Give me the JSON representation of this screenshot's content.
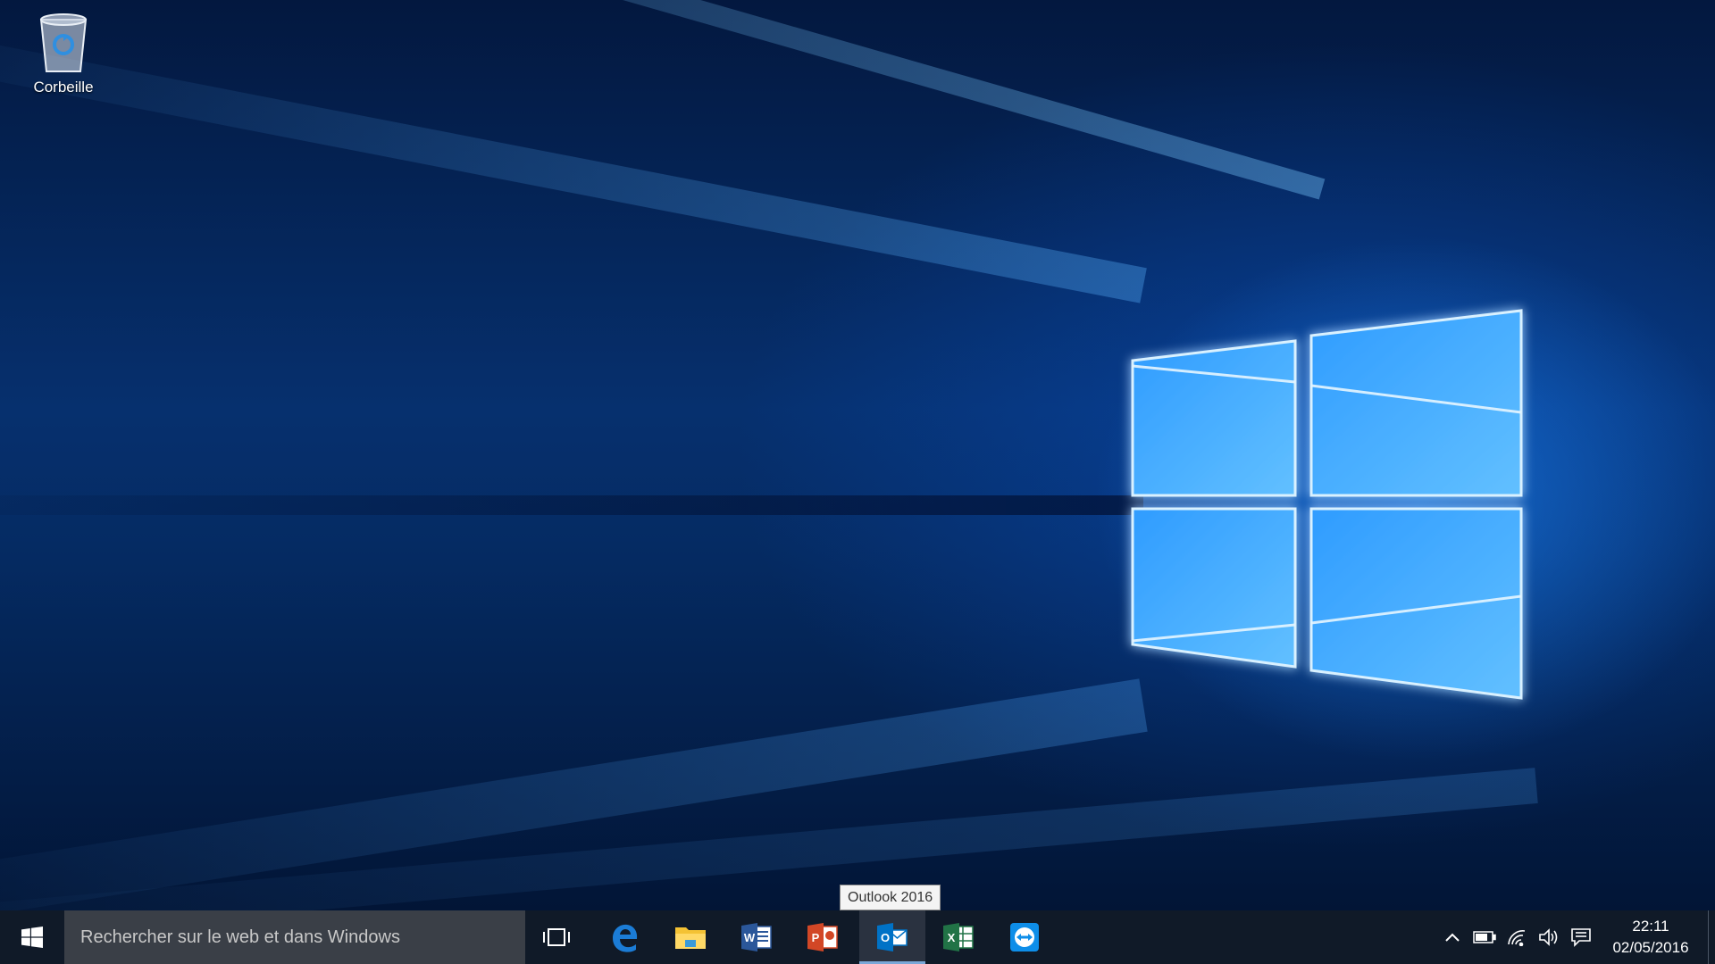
{
  "desktop": {
    "icons": [
      {
        "label": "Corbeille",
        "icon": "recycle-bin-icon"
      }
    ]
  },
  "tooltip": {
    "text": "Outlook 2016"
  },
  "taskbar": {
    "start_icon": "windows-logo-icon",
    "search": {
      "placeholder": "Rechercher sur le web et dans Windows"
    },
    "apps": [
      {
        "name": "Task View",
        "icon": "task-view-icon"
      },
      {
        "name": "Microsoft Edge",
        "icon": "edge-icon",
        "color": "#1b7cd6"
      },
      {
        "name": "File Explorer",
        "icon": "folder-icon",
        "color": "#f4c234"
      },
      {
        "name": "Word 2016",
        "icon": "word-icon",
        "color": "#2b579a"
      },
      {
        "name": "PowerPoint 2016",
        "icon": "powerpoint-icon",
        "color": "#d24726"
      },
      {
        "name": "Outlook 2016",
        "icon": "outlook-icon",
        "color": "#0072c6",
        "active": true
      },
      {
        "name": "Excel 2016",
        "icon": "excel-icon",
        "color": "#217346"
      },
      {
        "name": "TeamViewer",
        "icon": "teamviewer-icon",
        "color": "#0e8ee9"
      }
    ],
    "tray": {
      "icons": [
        "chevron-up-icon",
        "battery-icon",
        "wifi-icon",
        "volume-icon",
        "action-center-icon"
      ],
      "time": "22:11",
      "date": "02/05/2016"
    }
  }
}
